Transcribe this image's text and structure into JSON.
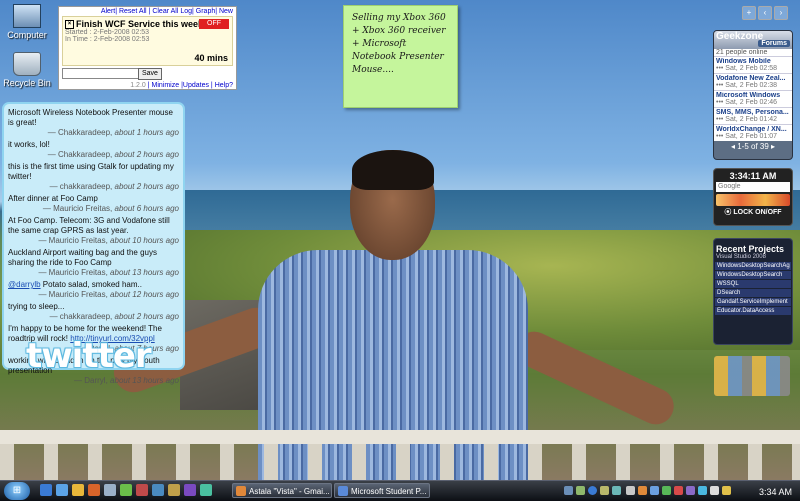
{
  "desktop_icons": [
    {
      "label": "Computer",
      "icon": "computer-icon"
    },
    {
      "label": "Recycle Bin",
      "icon": "recycle-bin-icon"
    }
  ],
  "todo": {
    "toplinks": "Alert| Reset All | Clear All Log| Graph| New",
    "task_title": "Finish WCF Service this weekend",
    "button": "OFF",
    "started": "Started : 2-Feb-2008 02:53",
    "in_time": "In Time : 2-Feb-2008 02:53",
    "minutes": "40 mins",
    "save_label": "Save",
    "version": "1.2.0",
    "links": {
      "minimize": "Minimize",
      "updates": "Updates",
      "help": "Help?"
    }
  },
  "sticky_note": {
    "text": "Selling my Xbox 360 + Xbox 360 receiver + Microsoft Notebook Presenter Mouse...."
  },
  "twitter": {
    "logo": "twitter",
    "tweets": [
      {
        "text": "Microsoft Wireless Notebook Presenter mouse is great!",
        "author": "— Chakkaradeep,",
        "time": "about 1 hours ago"
      },
      {
        "text": "it works, lol!",
        "author": "— Chakkaradeep,",
        "time": "about 2 hours ago"
      },
      {
        "text": "this is the first time using Gtalk for updating my twitter!",
        "author": "— chakkaradeep,",
        "time": "about 2 hours ago"
      },
      {
        "text": "After dinner at Foo Camp",
        "author": "— Mauricio Freitas,",
        "time": "about 6 hours ago"
      },
      {
        "text": "At Foo Camp. Telecom: 3G and Vodafone still the same crap GPRS as last year.",
        "author": "— Mauricio Freitas,",
        "time": "about 10 hours ago"
      },
      {
        "text": "Auckland Airport waiting bag and the guys sharing the ride to Foo Camp",
        "author": "— Mauricio Freitas,",
        "time": "about 13 hours ago"
      },
      {
        "text_prefix": "@darrylb",
        "text": " Potato salad, smoked ham..",
        "author": "— Mauricio Freitas,",
        "time": "about 12 hours ago"
      },
      {
        "text": "trying to sleep...",
        "author": "— chakkaradeep,",
        "time": "about 2 hours ago"
      },
      {
        "text": "I'm happy to be home for the weekend! The roadtrip will rock! ",
        "link": "http://tinyurl.com/32vppl",
        "author": "— Darryl,",
        "time": "about 7 hours ago"
      },
      {
        "text": "working with brendon on the new plymouth presentation",
        "author": "— Darryl,",
        "time": "about 13 hours ago"
      }
    ]
  },
  "geekzone": {
    "title": "Geekzone",
    "forums_label": "Forums",
    "online": "21 people online",
    "items": [
      {
        "title": "Windows Mobile",
        "date": "••• Sat, 2 Feb 02:58"
      },
      {
        "title": "Vodafone New Zeal...",
        "date": "••• Sat, 2 Feb 02:38"
      },
      {
        "title": "Microsoft Windows",
        "date": "••• Sat, 2 Feb 02:46"
      },
      {
        "title": "SMS, MMS, Persona...",
        "date": "••• Sat, 2 Feb 01:42"
      },
      {
        "title": "WorldxChange / XN...",
        "date": "••• Sat, 2 Feb 01:07"
      }
    ],
    "pager": "1-5 of 39"
  },
  "clock_gadget": {
    "time": "3:34:11 AM",
    "search_placeholder": "Google",
    "lock_label": "LOCK ON/OFF"
  },
  "recent_projects": {
    "title": "Recent Projects",
    "subtitle": "Visual Studio 2008",
    "items": [
      "WindowsDesktopSearchAg",
      "WindowsDesktopSearch",
      "WSSQL",
      "DSearch",
      "Gandalf.ServiceImplement",
      "Educator.DataAccess"
    ]
  },
  "taskbar": {
    "start_glyph": "⊞",
    "buttons": [
      {
        "label": "Astala \"Vista\" - Gmai..."
      },
      {
        "label": "Microsoft Student P..."
      }
    ],
    "clock": "3:34 AM"
  },
  "colors": {
    "twitter_bg": "#c9ecf9",
    "note_bg": "#c5f59c",
    "accent_red": "#e02020"
  }
}
